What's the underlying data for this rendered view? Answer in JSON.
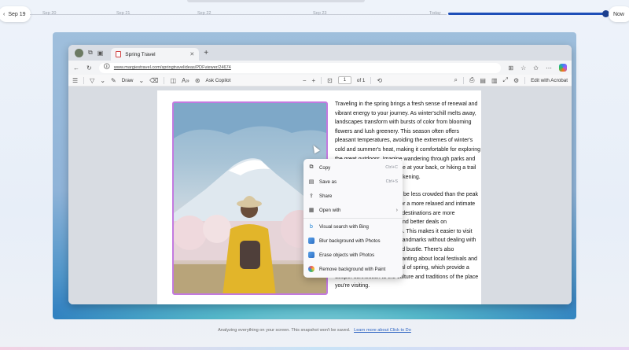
{
  "timeline": {
    "start_label": "Sep 19",
    "dates": [
      "Sep 20",
      "Sep 21",
      "Sep 22",
      "Sep 23"
    ],
    "today_label": "Today",
    "now_label": "Now"
  },
  "browser": {
    "tab_title": "Spring Travel",
    "url": "www.margiestravel.com/springtravelideas/PDFviewer/24674"
  },
  "pdf_toolbar": {
    "draw_label": "Draw",
    "ask_copilot_label": "Ask Copilot",
    "page_number": "1",
    "page_total": "of 1",
    "edit_acrobat_label": "Edit with Acrobat"
  },
  "document": {
    "paragraph1": "Traveling in the spring brings a fresh sense of renewal and vibrant energy to your journey. As winter'schill melts away, landscapes transform with bursts of color from blooming flowers and lush greenery. This season often offers pleasant temperatures, avoiding the extremes of winter's cold and summer's heat, making it comfortable for exploring the great outdoors. Imagine wandering through parks and gardens with a gentle breeze at your back, or hiking a trail surrounded by nature's awakening.",
    "paragraph2": "Additionally, spring tends to be less crowded than the peak summer months, allowing for a more relaxed and intimate experience. Popular tourist destinations are more accessible, and you might find better deals on accommodations and flights. This makes it easier to visit attractions, museums, and landmarks without dealing with the overwhelming hustle and bustle. There's also something particularly enchanting about local festivals and events celebrating the arrival of spring, which provide a deeper connection to the culture and traditions of the place you're visiting."
  },
  "context_menu": {
    "items": [
      {
        "label": "Copy",
        "shortcut": "Ctrl+C"
      },
      {
        "label": "Save as",
        "shortcut": "Ctrl+S"
      },
      {
        "label": "Share",
        "shortcut": ""
      },
      {
        "label": "Open with",
        "shortcut": ""
      },
      {
        "label": "Visual search with Bing",
        "shortcut": ""
      },
      {
        "label": "Blur background with Photos",
        "shortcut": ""
      },
      {
        "label": "Erase objects with Photos",
        "shortcut": ""
      },
      {
        "label": "Remove background with Paint",
        "shortcut": ""
      }
    ]
  },
  "footer": {
    "text": "Analyzing everything on your screen. This snapshot won't be saved.",
    "link": "Learn more about Click to Do"
  },
  "colors": {
    "accent": "#1e4fb8",
    "selection_border": "#c37ae0"
  }
}
